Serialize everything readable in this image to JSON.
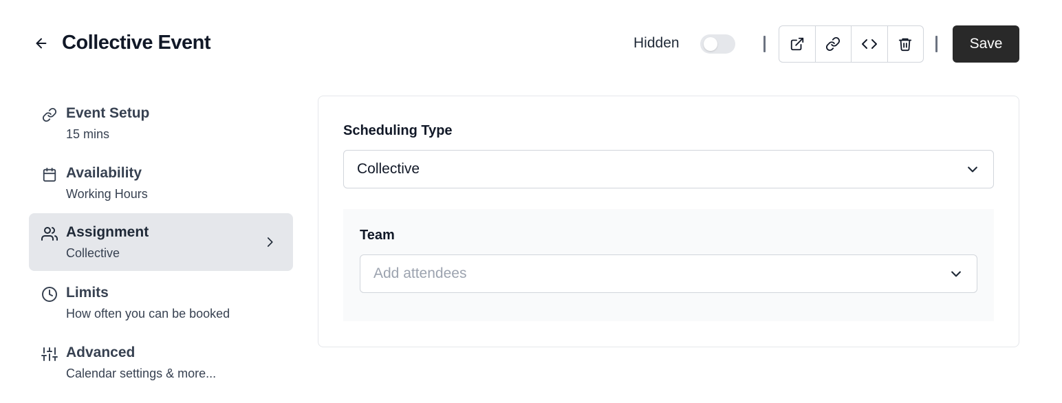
{
  "header": {
    "title": "Collective Event",
    "hidden_label": "Hidden",
    "hidden_toggle_on": false,
    "save_label": "Save",
    "action_icons": [
      "external-link-icon",
      "link-icon",
      "code-icon",
      "trash-icon"
    ]
  },
  "sidebar": {
    "items": [
      {
        "label": "Event Setup",
        "sub": "15 mins",
        "icon": "link-icon",
        "active": false
      },
      {
        "label": "Availability",
        "sub": "Working Hours",
        "icon": "calendar-icon",
        "active": false
      },
      {
        "label": "Assignment",
        "sub": "Collective",
        "icon": "users-icon",
        "active": true
      },
      {
        "label": "Limits",
        "sub": "How often you can be booked",
        "icon": "clock-icon",
        "active": false
      },
      {
        "label": "Advanced",
        "sub": "Calendar settings & more...",
        "icon": "sliders-icon",
        "active": false
      }
    ]
  },
  "main": {
    "scheduling_type": {
      "label": "Scheduling Type",
      "value": "Collective"
    },
    "team": {
      "label": "Team",
      "placeholder": "Add attendees"
    }
  },
  "colors": {
    "primary_button": "#292929",
    "active_nav_bg": "#e5e7eb",
    "toggle_off": "#e5e7eb",
    "team_panel_bg": "#f9fafb"
  }
}
